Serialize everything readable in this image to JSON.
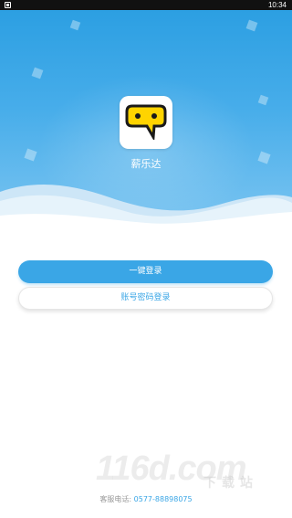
{
  "status_bar": {
    "time": "10:34"
  },
  "app": {
    "name": "薪乐达"
  },
  "buttons": {
    "one_click_login": "一键登录",
    "account_login": "账号密码登录"
  },
  "footer": {
    "service_label": "客服电话:",
    "service_phone": "0577-88898075"
  },
  "watermark": {
    "main": "116d.com",
    "sub": "下载站"
  },
  "colors": {
    "accent": "#3aa6e6",
    "header_top": "#2c9fe2",
    "logo_yellow": "#ffd400"
  }
}
